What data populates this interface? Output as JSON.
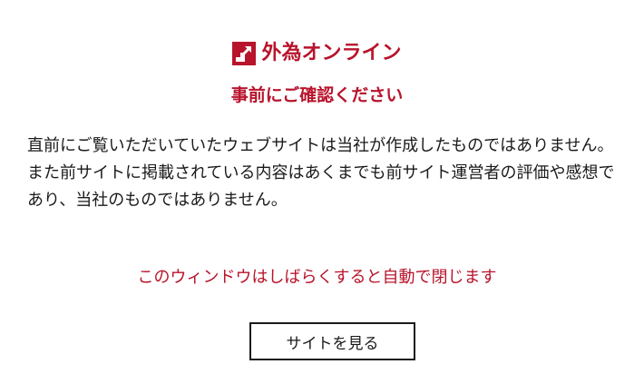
{
  "brand": {
    "name": "外為オンライン",
    "logo_icon": "stair-arrow-logo-icon",
    "color": "#b8142c"
  },
  "notice": {
    "title": "事前にご確認ください",
    "paragraphs": [
      "直前にご覧いただいていたウェブサイトは当社が作成したものではありません。",
      "また前サイトに掲載されている内容はあくまでも前サイト運営者の評価や感想であり、当社のものではありません。"
    ],
    "auto_close": "このウィンドウはしばらくすると自動で閉じます"
  },
  "actions": {
    "view_site": "サイトを見る"
  },
  "colors": {
    "accent": "#b8142c",
    "text": "#1a1a1a",
    "background": "#ffffff"
  }
}
